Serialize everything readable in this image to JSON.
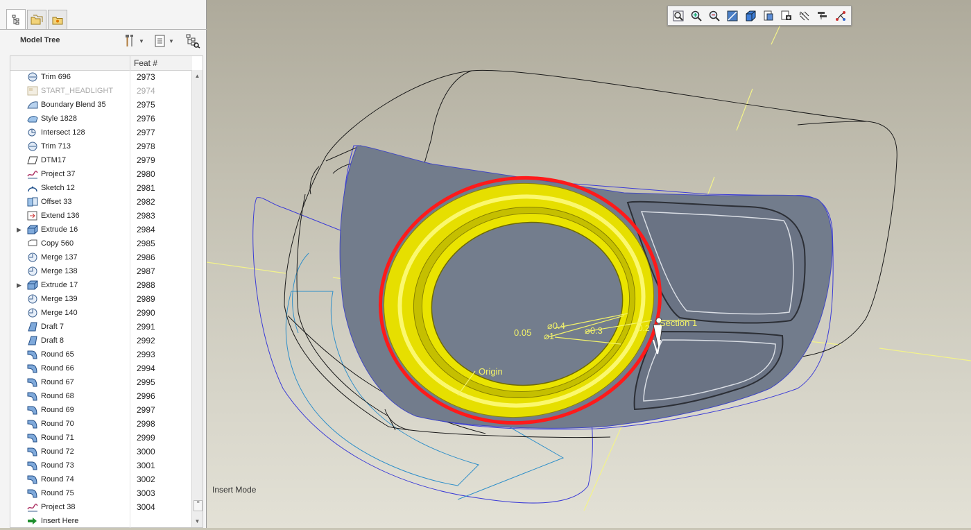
{
  "tabs": [
    {
      "icon": "model-tree-icon",
      "active": true
    },
    {
      "icon": "folder-browser-icon",
      "active": false
    },
    {
      "icon": "favorites-icon",
      "active": false
    }
  ],
  "model_tree": {
    "title": "Model Tree",
    "column_header": "Feat #",
    "rows": [
      {
        "label": "Trim 696",
        "feat": "2973",
        "icon": "trim-icon"
      },
      {
        "label": "START_HEADLIGHT",
        "feat": "2974",
        "icon": "layout-icon",
        "dim": true
      },
      {
        "label": "Boundary Blend 35",
        "feat": "2975",
        "icon": "boundary-blend-icon"
      },
      {
        "label": "Style 1828",
        "feat": "2976",
        "icon": "style-icon"
      },
      {
        "label": "Intersect 128",
        "feat": "2977",
        "icon": "intersect-icon"
      },
      {
        "label": "Trim 713",
        "feat": "2978",
        "icon": "trim-icon"
      },
      {
        "label": "DTM17",
        "feat": "2979",
        "icon": "datum-plane-icon"
      },
      {
        "label": "Project 37",
        "feat": "2980",
        "icon": "project-icon"
      },
      {
        "label": "Sketch 12",
        "feat": "2981",
        "icon": "sketch-icon"
      },
      {
        "label": "Offset 33",
        "feat": "2982",
        "icon": "offset-icon"
      },
      {
        "label": "Extend 136",
        "feat": "2983",
        "icon": "extend-icon"
      },
      {
        "label": "Extrude 16",
        "feat": "2984",
        "icon": "extrude-icon",
        "expandable": true
      },
      {
        "label": "Copy 560",
        "feat": "2985",
        "icon": "copy-icon"
      },
      {
        "label": "Merge 137",
        "feat": "2986",
        "icon": "merge-icon"
      },
      {
        "label": "Merge 138",
        "feat": "2987",
        "icon": "merge-icon"
      },
      {
        "label": "Extrude 17",
        "feat": "2988",
        "icon": "extrude-icon",
        "expandable": true
      },
      {
        "label": "Merge 139",
        "feat": "2989",
        "icon": "merge-icon"
      },
      {
        "label": "Merge 140",
        "feat": "2990",
        "icon": "merge-icon"
      },
      {
        "label": "Draft 7",
        "feat": "2991",
        "icon": "draft-icon"
      },
      {
        "label": "Draft 8",
        "feat": "2992",
        "icon": "draft-icon"
      },
      {
        "label": "Round 65",
        "feat": "2993",
        "icon": "round-icon"
      },
      {
        "label": "Round 66",
        "feat": "2994",
        "icon": "round-icon"
      },
      {
        "label": "Round 67",
        "feat": "2995",
        "icon": "round-icon"
      },
      {
        "label": "Round 68",
        "feat": "2996",
        "icon": "round-icon"
      },
      {
        "label": "Round 69",
        "feat": "2997",
        "icon": "round-icon"
      },
      {
        "label": "Round 70",
        "feat": "2998",
        "icon": "round-icon"
      },
      {
        "label": "Round 71",
        "feat": "2999",
        "icon": "round-icon"
      },
      {
        "label": "Round 72",
        "feat": "3000",
        "icon": "round-icon"
      },
      {
        "label": "Round 73",
        "feat": "3001",
        "icon": "round-icon"
      },
      {
        "label": "Round 74",
        "feat": "3002",
        "icon": "round-icon"
      },
      {
        "label": "Round 75",
        "feat": "3003",
        "icon": "round-icon"
      },
      {
        "label": "Project 38",
        "feat": "3004",
        "icon": "project-icon"
      },
      {
        "label": "Insert Here",
        "feat": "",
        "icon": "insert-here-arrow-icon"
      }
    ]
  },
  "viewport": {
    "status": "Insert Mode",
    "toolbar": [
      "refit-icon",
      "zoom-in-icon",
      "zoom-out-icon",
      "repaint-icon",
      "display-style-icon",
      "saved-orientations-icon",
      "view-manager-icon",
      "datum-display-icon",
      "annotation-display-icon",
      "spin-center-icon"
    ],
    "annotations": {
      "section": "Section 1",
      "origin": "Origin",
      "dim_a": "0.05",
      "dim_b": "0.4",
      "dim_c": "1",
      "dim_d": "0.3",
      "dim_e": "0.2"
    },
    "colors": {
      "highlight": "#ff1a1a",
      "tube": "#e8e000",
      "surface": "#727c8c",
      "wire": "#3b3bd6",
      "datum": "#f0f07a"
    }
  }
}
